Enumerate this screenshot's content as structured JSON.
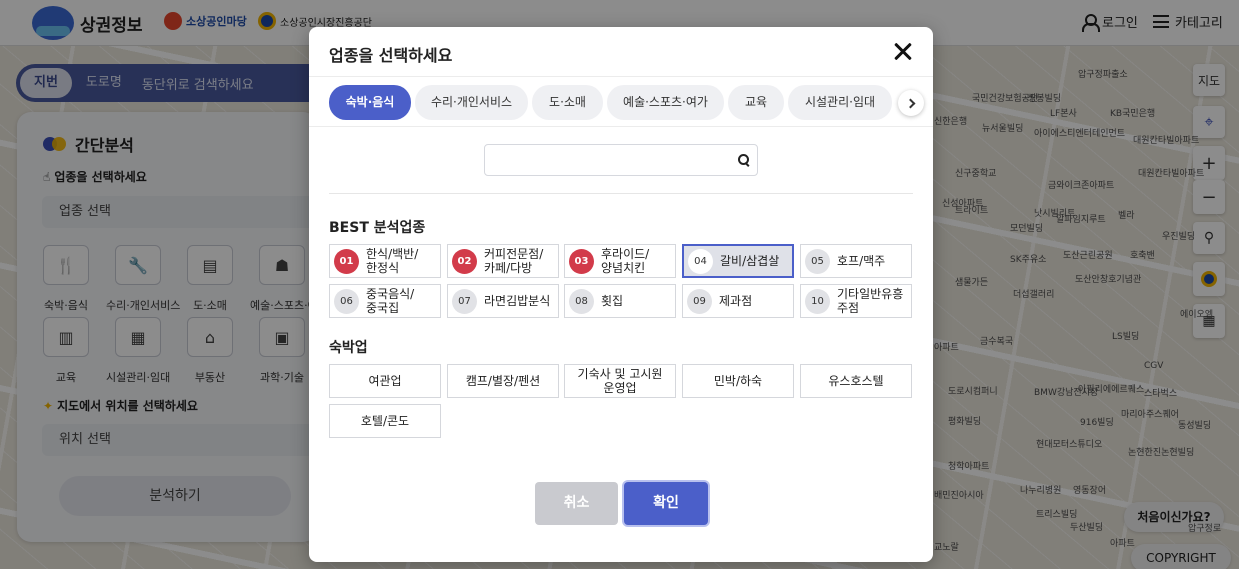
{
  "header": {
    "brand_title": "상권정보",
    "partner1": "소상공인마당",
    "partner2": "소상공인시장진흥공단",
    "login": "로그인",
    "category": "카테고리"
  },
  "search": {
    "mode_jibun": "지번",
    "mode_road": "도로명",
    "placeholder": "동단위로 검색하세요"
  },
  "panel": {
    "title": "간단분석",
    "step1": "업종을 선택하세요",
    "step1_select": "업종 선택",
    "categories": [
      {
        "label": "숙박·음식",
        "icon": "fork-knife-icon",
        "glyph": "🍴"
      },
      {
        "label": "수리·개인서비스",
        "icon": "tools-icon",
        "glyph": "🔧"
      },
      {
        "label": "도·소매",
        "icon": "shop-icon",
        "glyph": "▤"
      },
      {
        "label": "예술·스포츠·여",
        "icon": "art-icon",
        "glyph": "☗"
      },
      {
        "label": "교육",
        "icon": "book-icon",
        "glyph": "▥"
      },
      {
        "label": "시설관리·임대",
        "icon": "building-icon",
        "glyph": "▦"
      },
      {
        "label": "부동산",
        "icon": "house-icon",
        "glyph": "⌂"
      },
      {
        "label": "과학·기술",
        "icon": "monitor-icon",
        "glyph": "▣"
      }
    ],
    "step2": "지도에서 위치를 선택하세요",
    "step2_select": "위치 선택",
    "analyze_button": "분석하기"
  },
  "map": {
    "controls": {
      "map_type": "지도",
      "zoom_in": "+",
      "zoom_out": "−"
    },
    "first_time": "처음이신가요?",
    "copyright": "COPYRIGHT",
    "labels": [
      "압구정파출소",
      "국민건강보험공단",
      "쌍봉빌딩",
      "LF본사",
      "KB국민은행",
      "신한은행",
      "뉴서울빌딩",
      "아이에스티엔터테인먼트",
      "대원칸타빌아파트",
      "신구중학교",
      "금와이크존아파트",
      "대원칸타빌아파트",
      "신성아파트",
      "낫시빌리트",
      "벨라",
      "트라이트",
      "모던빌딩",
      "알파임지루트",
      "호축밴",
      "우진빌딩",
      "SK주유소",
      "도산근린공원",
      "샘물가든",
      "더섭갤러리",
      "도산안창호기념관",
      "에이오엠",
      "금수복국",
      "LS빌딩",
      "아파트",
      "CGV",
      "도로시컴퍼니",
      "BMW강남전시장",
      "아필리에에르퀘스",
      "스타벅스",
      "평화빌딩",
      "916빌딩",
      "마리아주스퀘어",
      "동성빌딩",
      "청학아파트",
      "현대모터스튜디오",
      "논현한진논현빌딩",
      "배민진아시아",
      "나누리병원",
      "영동장어",
      "트리스빌딩",
      "두산빌딩",
      "압구정로",
      "아파트",
      "교노랄"
    ]
  },
  "modal": {
    "title": "업종을 선택하세요",
    "tabs": [
      "숙박·음식",
      "수리·개인서비스",
      "도·소매",
      "예술·스포츠·여가",
      "교육",
      "시설관리·임대"
    ],
    "search_placeholder": "",
    "best_heading": "BEST 분석업종",
    "best": [
      {
        "rank": "01",
        "name": "한식/백반/\n한정식"
      },
      {
        "rank": "02",
        "name": "커피전문점/\n카페/다방"
      },
      {
        "rank": "03",
        "name": "후라이드/\n양념치킨"
      },
      {
        "rank": "04",
        "name": "갈비/삼겹살"
      },
      {
        "rank": "05",
        "name": "호프/맥주"
      },
      {
        "rank": "06",
        "name": "중국음식/\n중국집"
      },
      {
        "rank": "07",
        "name": "라면김밥분식"
      },
      {
        "rank": "08",
        "name": "횟집"
      },
      {
        "rank": "09",
        "name": "제과점"
      },
      {
        "rank": "10",
        "name": "기타일반유흥\n주점"
      }
    ],
    "lodging_heading": "숙박업",
    "lodging": [
      "여관업",
      "캠프/별장/펜션",
      "기숙사 및 고시원\n운영업",
      "민박/하숙",
      "유스호스텔",
      "호텔/콘도"
    ],
    "cancel": "취소",
    "confirm": "확인"
  },
  "colors": {
    "accent": "#4b5fc9",
    "rank_top": "#d23b4a",
    "dim": "rgba(0,0,0,0.45)"
  }
}
